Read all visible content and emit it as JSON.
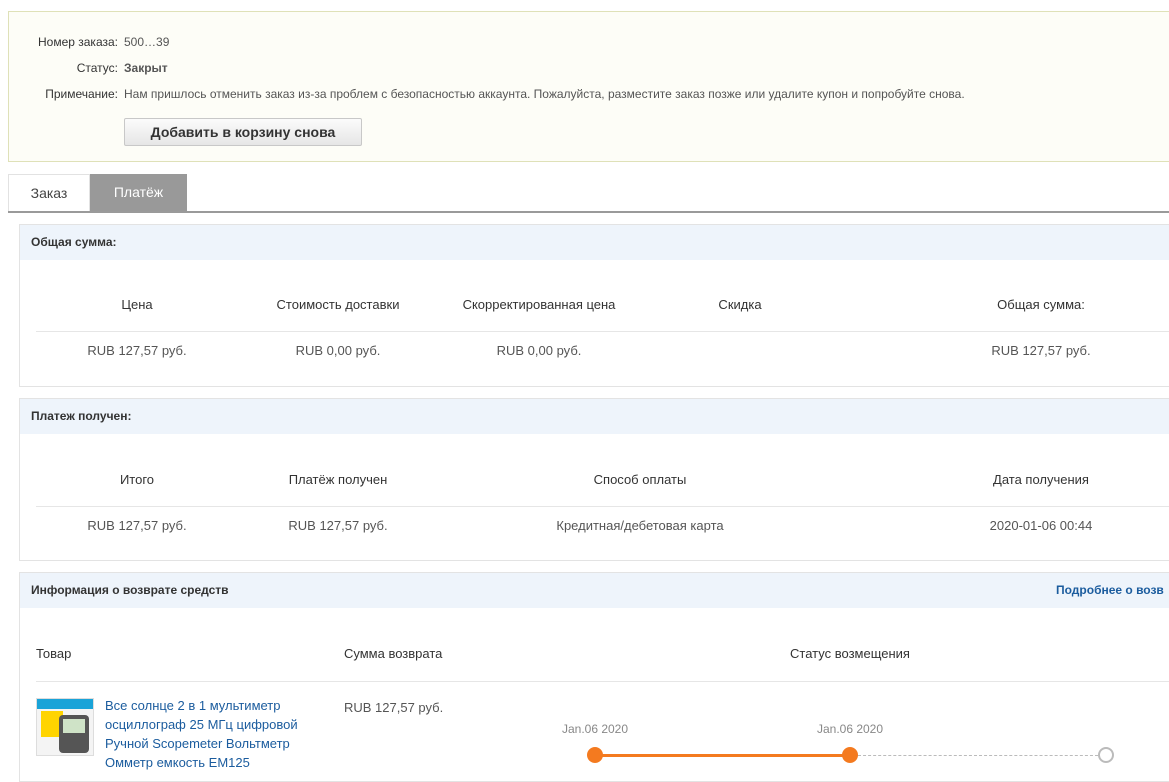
{
  "order": {
    "number_label": "Номер заказа:",
    "number_value": "500…39",
    "status_label": "Статус:",
    "status_value": "Закрыт",
    "note_label": "Примечание:",
    "note_value": "Нам пришлось отменить заказ из-за проблем с безопасностью аккаунта. Пожалуйста, разместите заказ позже или удалите купон и попробуйте снова.",
    "add_to_cart_label": "Добавить в корзину снова"
  },
  "tabs": [
    {
      "label": "Заказ",
      "active": false
    },
    {
      "label": "Платёж",
      "active": true
    }
  ],
  "total": {
    "title": "Общая сумма:",
    "headers": [
      "Цена",
      "Стоимость доставки",
      "Скорректированная цена",
      "Скидка",
      "Общая сумма:"
    ],
    "values": [
      "RUB 127,57 руб.",
      "RUB 0,00 руб.",
      "RUB 0,00 руб.",
      "",
      "RUB 127,57 руб."
    ]
  },
  "payment": {
    "title": "Платеж получен:",
    "headers": [
      "Итого",
      "Платёж получен",
      "Способ оплаты",
      "Дата получения"
    ],
    "values": [
      "RUB 127,57 руб.",
      "RUB 127,57 руб.",
      "Кредитная/дебетовая карта",
      "2020-01-06 00:44"
    ]
  },
  "refund": {
    "title": "Информация о возврате средств",
    "more_link": "Подробнее о возв",
    "headers": {
      "product": "Товар",
      "amount": "Сумма возврата",
      "status": "Статус возмещения"
    },
    "item": {
      "name": "Все солнце 2 в 1 мультиметр осциллограф 25 МГц цифровой Ручной Scopemeter Вольтметр Омметр емкость EM125",
      "amount": "RUB 127,57 руб."
    },
    "timeline": {
      "dates": [
        "Jan.06 2020",
        "Jan.06 2020"
      ],
      "completed_steps": 2,
      "total_steps": 3
    }
  },
  "colors": {
    "status_green": "#2a9a22",
    "link_blue": "#1b5c9e",
    "timeline_orange": "#f47a1f",
    "panel_header_bg": "#eef4fb",
    "active_tab_bg": "#999999"
  }
}
